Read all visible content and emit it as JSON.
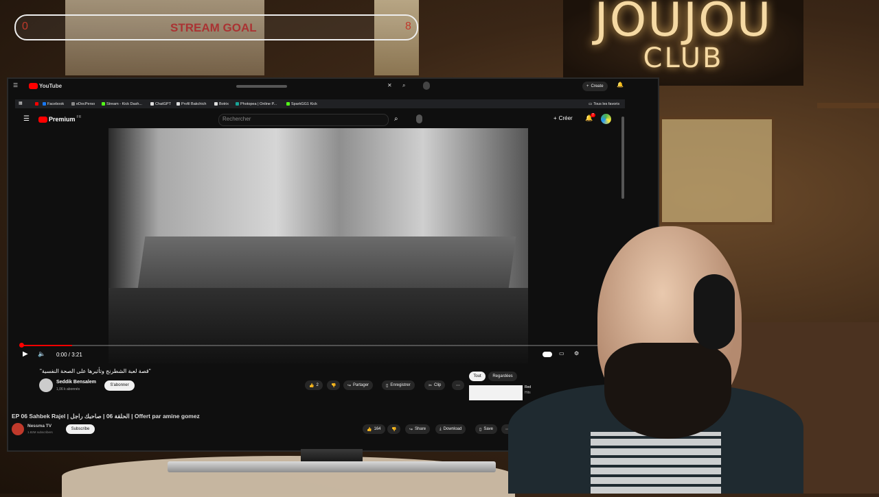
{
  "stream_goal": {
    "min": "0",
    "title": "STREAM GOAL",
    "max": "8"
  },
  "overlay_sign": {
    "title": "JOUJOU",
    "subtitle": "CLUB"
  },
  "outer_youtube": {
    "logo": "YouTube",
    "create_label": "Create",
    "video_title": "EP 06 Sahbek Rajel | الحلقة 06 | صاحبك راجل | Offert par amine gomez",
    "channel_name": "Nessma TV",
    "channel_subs": "1.82M subscribers",
    "subscribe_label": "Subscribe",
    "likes": "164",
    "share_label": "Share",
    "download_label": "Download",
    "save_label": "Save"
  },
  "bookmarks": [
    {
      "label": "Facebook",
      "color": "#1877f2"
    },
    {
      "label": "eDocPerso",
      "color": "#888888"
    },
    {
      "label": "Stream - Kick Dash...",
      "color": "#53fc18"
    },
    {
      "label": "ChatGPT",
      "color": "#dddddd"
    },
    {
      "label": "Profil Bakchich",
      "color": "#dddddd"
    },
    {
      "label": "Botrix",
      "color": "#dddddd"
    },
    {
      "label": "Photopea | Online P...",
      "color": "#18a497"
    },
    {
      "label": "SparkGG1 Kick",
      "color": "#53fc18"
    }
  ],
  "all_bookmarks_label": "Tous les favoris",
  "youtube": {
    "logo": "Premium",
    "logo_suffix": "FR",
    "search_placeholder": "Rechercher",
    "create_label": "Créer",
    "notif_count": "7",
    "time": "0:00 / 3:21",
    "progress": 0.086,
    "video_title": "\"قصة لعبة الشطرنج وتأثيرها على الصحة النفسية\"",
    "channel_name": "Seddik Bensalem",
    "channel_subs": "1,06 k abonnés",
    "subscribe_label": "S'abonner",
    "likes": "2",
    "share_label": "Partager",
    "save_label": "Enregistrer",
    "clip_label": "Clip",
    "chips": [
      "Tout",
      "Regardées"
    ],
    "rec_text": [
      "Red",
      "Hits"
    ]
  },
  "colors": {
    "youtube_red": "#ff0000",
    "goal_text": "#aa3333"
  }
}
